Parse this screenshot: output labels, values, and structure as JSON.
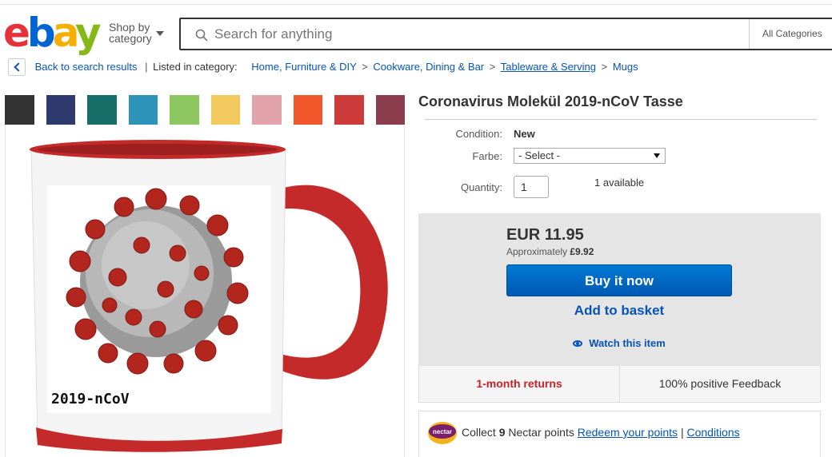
{
  "header": {
    "logo_text": {
      "e": "e",
      "b": "b",
      "a": "a",
      "y": "y"
    },
    "shop_by_line1": "Shop by",
    "shop_by_line2": "category",
    "search_placeholder": "Search for anything",
    "all_categories": "All Categories"
  },
  "breadcrumb": {
    "back": "Back to search results",
    "separator": "|",
    "listed_in": "Listed in category:",
    "items": [
      "Home, Furniture & DIY",
      "Cookware, Dining & Bar",
      "Tableware & Serving",
      "Mugs"
    ],
    "arrow": ">"
  },
  "swatches": [
    "#333333",
    "#2e3a6e",
    "#176d68",
    "#2d93b8",
    "#8ec760",
    "#f2c95e",
    "#e3a3ab",
    "#f2572b",
    "#cc3a3a",
    "#8c3d4d"
  ],
  "product": {
    "title": "Coronavirus Molekül 2019-nCoV Tasse",
    "mug_text": "2019-nCoV",
    "condition_label": "Condition:",
    "condition_value": "New",
    "farbe_label": "Farbe:",
    "farbe_value": "- Select -",
    "quantity_label": "Quantity:",
    "quantity_value": "1",
    "available": "1 available"
  },
  "buy": {
    "price": "EUR 11.95",
    "approx_label": "Approximately",
    "approx_value": "£9.92",
    "buy_now": "Buy it now",
    "add_basket": "Add to basket",
    "watch": "Watch this item"
  },
  "features": {
    "returns": "1-month returns",
    "feedback": "100% positive Feedback"
  },
  "nectar": {
    "logo": "nectar",
    "collect": "Collect",
    "points": "9",
    "points_suffix": "Nectar points",
    "redeem": "Redeem your points",
    "sep": "|",
    "conditions": "Conditions"
  },
  "colors": {
    "accent_blue": "#0654ba",
    "mug_red": "#c42a2a",
    "returns_red": "#c7222a"
  }
}
